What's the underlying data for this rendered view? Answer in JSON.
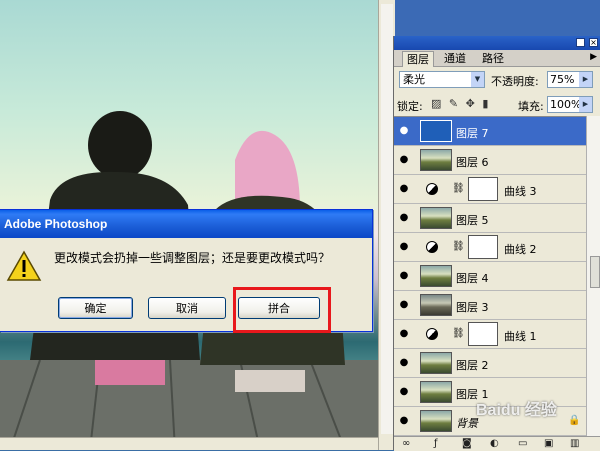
{
  "dialog": {
    "title": "Adobe Photoshop",
    "message": "更改模式会扔掉一些调整图层；还是要更改模式吗？",
    "buttons": {
      "ok": "确定",
      "cancel": "取消",
      "flatten": "拼合"
    }
  },
  "layers_panel": {
    "tabs": [
      "图层",
      "通道",
      "路径"
    ],
    "active_tab": "图层",
    "blend_mode": "柔光",
    "opacity_label": "不透明度:",
    "opacity": "75%",
    "lock_label": "锁定:",
    "fill_label": "填充:",
    "fill": "100%",
    "layers": [
      {
        "name": "图层 7",
        "kind": "pixel",
        "thumb": "blue",
        "selected": true
      },
      {
        "name": "图层 6",
        "kind": "pixel",
        "thumb": "photo"
      },
      {
        "name": "曲线 3",
        "kind": "adjustment"
      },
      {
        "name": "图层 5",
        "kind": "pixel",
        "thumb": "photo"
      },
      {
        "name": "曲线 2",
        "kind": "adjustment"
      },
      {
        "name": "图层 4",
        "kind": "pixel",
        "thumb": "photo"
      },
      {
        "name": "图层 3",
        "kind": "pixel",
        "thumb": "dark"
      },
      {
        "name": "曲线 1",
        "kind": "adjustment"
      },
      {
        "name": "图层 2",
        "kind": "pixel",
        "thumb": "photo"
      },
      {
        "name": "图层 1",
        "kind": "pixel",
        "thumb": "photo"
      },
      {
        "name": "背景",
        "kind": "background",
        "thumb": "photo"
      }
    ]
  },
  "watermark": "Baidu 经验",
  "colors": {
    "highlight": "#e8181c",
    "titlebar": "#0b47c7",
    "selected": "#3b6ac8"
  }
}
